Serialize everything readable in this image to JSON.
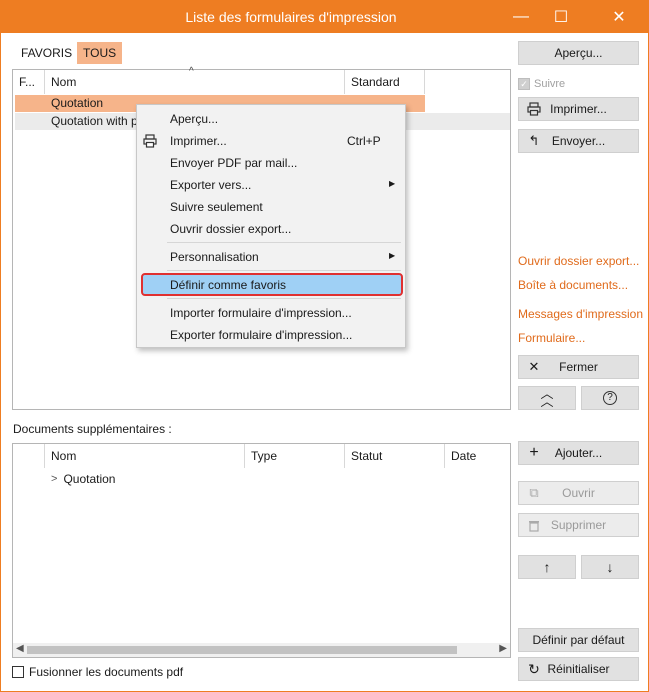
{
  "window": {
    "title": "Liste des formulaires d'impression",
    "controls": {
      "minimize": "—",
      "maximize": "☐",
      "close": "✕"
    }
  },
  "tabs": [
    {
      "label": "FAVORIS",
      "active": false
    },
    {
      "label": "TOUS",
      "active": true
    }
  ],
  "forms_list": {
    "columns": [
      "F...",
      "Nom",
      "Standard"
    ],
    "sort_indicator": "^",
    "rows": [
      {
        "name": "Quotation",
        "selected": true
      },
      {
        "name": "Quotation with pe",
        "selected": false
      }
    ]
  },
  "context_menu": {
    "items": [
      {
        "label": "Aperçu...",
        "shortcut": "",
        "icon": "",
        "submenu": false
      },
      {
        "label": "Imprimer...",
        "shortcut": "Ctrl+P",
        "icon": "printer-icon",
        "submenu": false
      },
      {
        "label": "Envoyer PDF par mail...",
        "shortcut": "",
        "icon": "",
        "submenu": false
      },
      {
        "label": "Exporter vers...",
        "shortcut": "",
        "icon": "",
        "submenu": true
      },
      {
        "label": "Suivre seulement",
        "shortcut": "",
        "icon": "",
        "submenu": false
      },
      {
        "label": "Ouvrir dossier export...",
        "shortcut": "",
        "icon": "",
        "submenu": false
      },
      {
        "label": "Personnalisation",
        "shortcut": "",
        "icon": "",
        "submenu": true
      },
      {
        "label": "Définir comme favoris",
        "shortcut": "",
        "icon": "",
        "submenu": false,
        "highlighted": true
      },
      {
        "label": "Importer formulaire d'impression...",
        "shortcut": "",
        "icon": "",
        "submenu": false
      },
      {
        "label": "Exporter formulaire d'impression...",
        "shortcut": "",
        "icon": "",
        "submenu": false
      }
    ]
  },
  "additional_docs": {
    "label": "Documents supplémentaires :",
    "columns": [
      "Nom",
      "Type",
      "Statut",
      "Date"
    ],
    "rows": [
      {
        "name": "Quotation",
        "expander": ">"
      }
    ]
  },
  "merge_pdf": {
    "label": "Fusionner les documents pdf",
    "checked": false
  },
  "right_panel": {
    "apercu": "Aperçu...",
    "suivre": {
      "label": "Suivre",
      "checked": true,
      "disabled": true
    },
    "imprimer": "Imprimer...",
    "envoyer": "Envoyer...",
    "links": [
      "Ouvrir dossier export...",
      "Boîte à documents...",
      "Messages d'impression",
      "Formulaire..."
    ],
    "fermer": "Fermer",
    "ajouter": "Ajouter...",
    "ouvrir": "Ouvrir",
    "supprimer": "Supprimer",
    "definir_defaut": "Définir par défaut",
    "reinitialiser": "Réinitialiser"
  },
  "colors": {
    "accent": "#ee7d22",
    "selection": "#f6b48a",
    "link": "#e06b1c",
    "menu_highlight": "#9fd0f5",
    "highlight_border": "#e03030"
  }
}
